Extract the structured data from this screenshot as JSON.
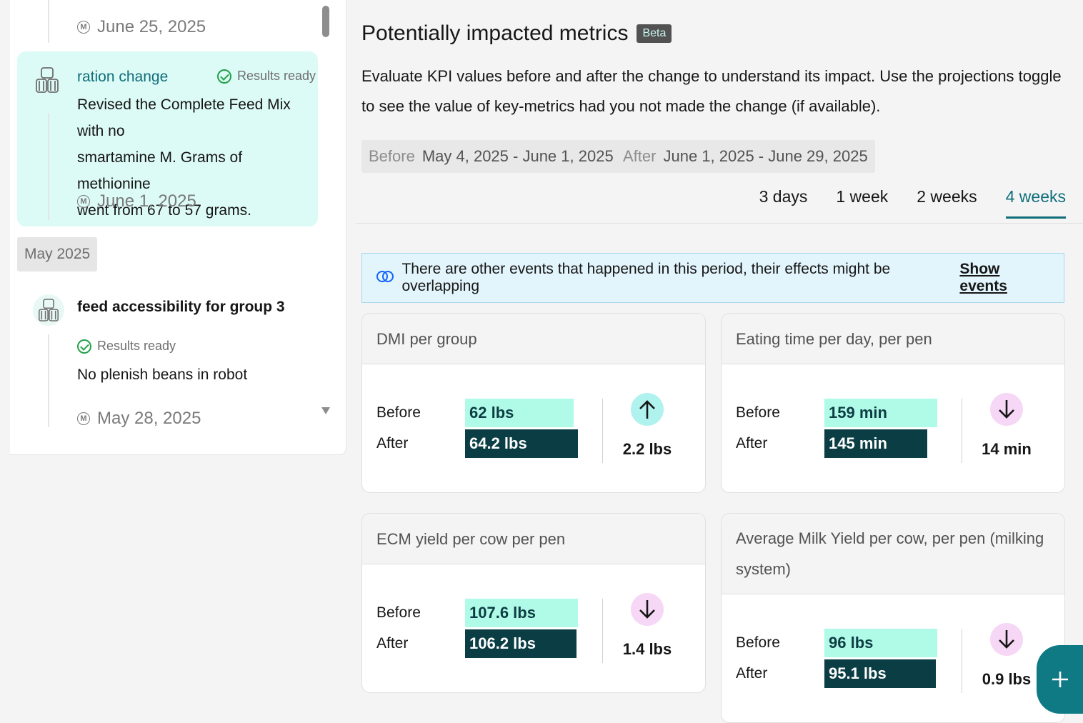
{
  "timeline": {
    "top_date": "June 25, 2025",
    "event1": {
      "title": "ration change",
      "status": "Results ready",
      "description_lines": [
        "Revised the Complete Feed Mix with no",
        "smartamine M. Grams of methionine",
        "went from 67 to 57 grams."
      ],
      "date": "June 1, 2025"
    },
    "month_label": "May 2025",
    "event2": {
      "title": "feed accessibility for group 3",
      "status": "Results ready",
      "description": "No plenish beans in robot",
      "date": "May 28, 2025"
    }
  },
  "main": {
    "title": "Potentially impacted metrics",
    "badge": "Beta",
    "description": "Evaluate KPI values before and after the change to understand its impact. Use the projections toggle to see the value of key-metrics had you not made the change (if available).",
    "before_label": "Before",
    "before_range": "May 4, 2025 - June 1, 2025",
    "after_label": "After",
    "after_range": "June 1, 2025 - June 29, 2025",
    "tabs": [
      "3 days",
      "1 week",
      "2 weeks",
      "4 weeks"
    ],
    "active_tab": "4 weeks",
    "notice_text": "There are other events that happened in this period, their effects might be overlapping",
    "notice_link": "Show events"
  },
  "metrics": [
    {
      "title": "DMI per group",
      "before_label": "Before",
      "after_label": "After",
      "before": "62 lbs",
      "after": "64.2 lbs",
      "before_fraction": 0.8,
      "after_fraction": 0.83,
      "direction": "up",
      "delta": "2.2  lbs"
    },
    {
      "title": "Eating time per day, per pen",
      "before_label": "Before",
      "after_label": "After",
      "before": "159 min",
      "after": "145 min",
      "before_fraction": 0.83,
      "after_fraction": 0.76,
      "direction": "down",
      "delta": "14  min"
    },
    {
      "title": "ECM yield per cow per pen",
      "before_label": "Before",
      "after_label": "After",
      "before": "107.6 lbs",
      "after": "106.2 lbs",
      "before_fraction": 0.83,
      "after_fraction": 0.82,
      "direction": "down",
      "delta": "1.4  lbs"
    },
    {
      "title": "Average Milk Yield per cow, per pen (milking system)",
      "before_label": "Before",
      "after_label": "After",
      "before": "96 lbs",
      "after": "95.1 lbs",
      "before_fraction": 0.83,
      "after_fraction": 0.82,
      "direction": "down",
      "delta": "0.9  lbs"
    }
  ],
  "fab_icon": "plus-icon"
}
